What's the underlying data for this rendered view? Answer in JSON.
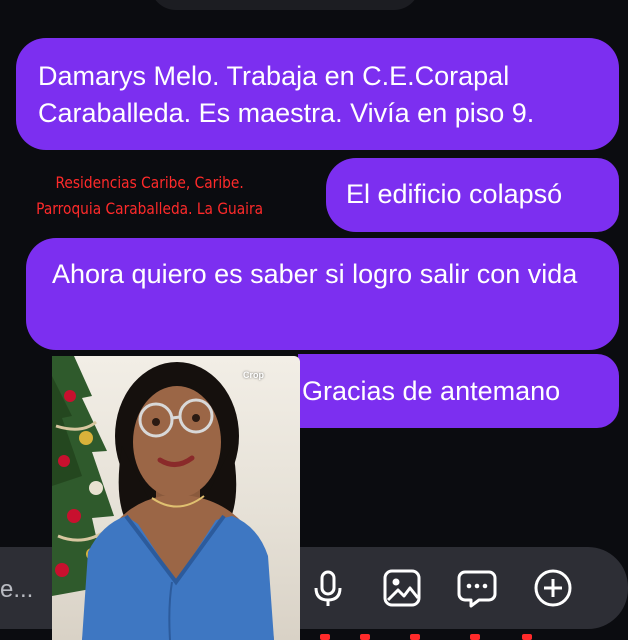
{
  "messages": [
    {
      "text": "Damarys Melo. Trabaja en C.E.Corapal Caraballeda. Es maestra. Vivía en piso 9."
    },
    {
      "text": "El edificio colapsó"
    },
    {
      "text": "Ahora quiero es saber si logro salir con vida"
    },
    {
      "text": "Gracias de antemano"
    }
  ],
  "caption": {
    "line1": "Residencias Caribe, Caribe.",
    "line2": "Parroquia Caraballeda. La Guaira"
  },
  "photo": {
    "crop_label": "Crop"
  },
  "composer": {
    "placeholder": "e...",
    "icons": [
      "mic-icon",
      "gallery-icon",
      "sticker-icon",
      "add-icon"
    ]
  },
  "colors": {
    "bubble": "#7c2ff0",
    "caption": "#ff2a2a",
    "background": "#0b0c10",
    "composer": "#2d2e35"
  }
}
